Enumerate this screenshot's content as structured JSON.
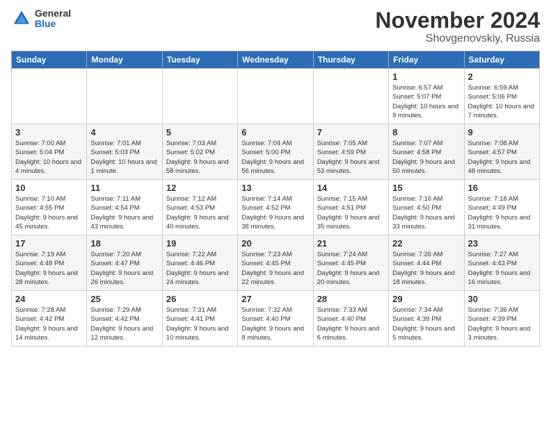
{
  "logo": {
    "general": "General",
    "blue": "Blue"
  },
  "title": "November 2024",
  "subtitle": "Shovgenovskiy, Russia",
  "days_of_week": [
    "Sunday",
    "Monday",
    "Tuesday",
    "Wednesday",
    "Thursday",
    "Friday",
    "Saturday"
  ],
  "weeks": [
    [
      {
        "day": "",
        "info": ""
      },
      {
        "day": "",
        "info": ""
      },
      {
        "day": "",
        "info": ""
      },
      {
        "day": "",
        "info": ""
      },
      {
        "day": "",
        "info": ""
      },
      {
        "day": "1",
        "info": "Sunrise: 6:57 AM\nSunset: 5:07 PM\nDaylight: 10 hours and 9 minutes."
      },
      {
        "day": "2",
        "info": "Sunrise: 6:59 AM\nSunset: 5:06 PM\nDaylight: 10 hours and 7 minutes."
      }
    ],
    [
      {
        "day": "3",
        "info": "Sunrise: 7:00 AM\nSunset: 5:04 PM\nDaylight: 10 hours and 4 minutes."
      },
      {
        "day": "4",
        "info": "Sunrise: 7:01 AM\nSunset: 5:03 PM\nDaylight: 10 hours and 1 minute."
      },
      {
        "day": "5",
        "info": "Sunrise: 7:03 AM\nSunset: 5:02 PM\nDaylight: 9 hours and 58 minutes."
      },
      {
        "day": "6",
        "info": "Sunrise: 7:04 AM\nSunset: 5:00 PM\nDaylight: 9 hours and 56 minutes."
      },
      {
        "day": "7",
        "info": "Sunrise: 7:05 AM\nSunset: 4:59 PM\nDaylight: 9 hours and 53 minutes."
      },
      {
        "day": "8",
        "info": "Sunrise: 7:07 AM\nSunset: 4:58 PM\nDaylight: 9 hours and 50 minutes."
      },
      {
        "day": "9",
        "info": "Sunrise: 7:08 AM\nSunset: 4:57 PM\nDaylight: 9 hours and 48 minutes."
      }
    ],
    [
      {
        "day": "10",
        "info": "Sunrise: 7:10 AM\nSunset: 4:55 PM\nDaylight: 9 hours and 45 minutes."
      },
      {
        "day": "11",
        "info": "Sunrise: 7:11 AM\nSunset: 4:54 PM\nDaylight: 9 hours and 43 minutes."
      },
      {
        "day": "12",
        "info": "Sunrise: 7:12 AM\nSunset: 4:53 PM\nDaylight: 9 hours and 40 minutes."
      },
      {
        "day": "13",
        "info": "Sunrise: 7:14 AM\nSunset: 4:52 PM\nDaylight: 9 hours and 38 minutes."
      },
      {
        "day": "14",
        "info": "Sunrise: 7:15 AM\nSunset: 4:51 PM\nDaylight: 9 hours and 35 minutes."
      },
      {
        "day": "15",
        "info": "Sunrise: 7:16 AM\nSunset: 4:50 PM\nDaylight: 9 hours and 33 minutes."
      },
      {
        "day": "16",
        "info": "Sunrise: 7:18 AM\nSunset: 4:49 PM\nDaylight: 9 hours and 31 minutes."
      }
    ],
    [
      {
        "day": "17",
        "info": "Sunrise: 7:19 AM\nSunset: 4:48 PM\nDaylight: 9 hours and 28 minutes."
      },
      {
        "day": "18",
        "info": "Sunrise: 7:20 AM\nSunset: 4:47 PM\nDaylight: 9 hours and 26 minutes."
      },
      {
        "day": "19",
        "info": "Sunrise: 7:22 AM\nSunset: 4:46 PM\nDaylight: 9 hours and 24 minutes."
      },
      {
        "day": "20",
        "info": "Sunrise: 7:23 AM\nSunset: 4:45 PM\nDaylight: 9 hours and 22 minutes."
      },
      {
        "day": "21",
        "info": "Sunrise: 7:24 AM\nSunset: 4:45 PM\nDaylight: 9 hours and 20 minutes."
      },
      {
        "day": "22",
        "info": "Sunrise: 7:26 AM\nSunset: 4:44 PM\nDaylight: 9 hours and 18 minutes."
      },
      {
        "day": "23",
        "info": "Sunrise: 7:27 AM\nSunset: 4:43 PM\nDaylight: 9 hours and 16 minutes."
      }
    ],
    [
      {
        "day": "24",
        "info": "Sunrise: 7:28 AM\nSunset: 4:42 PM\nDaylight: 9 hours and 14 minutes."
      },
      {
        "day": "25",
        "info": "Sunrise: 7:29 AM\nSunset: 4:42 PM\nDaylight: 9 hours and 12 minutes."
      },
      {
        "day": "26",
        "info": "Sunrise: 7:31 AM\nSunset: 4:41 PM\nDaylight: 9 hours and 10 minutes."
      },
      {
        "day": "27",
        "info": "Sunrise: 7:32 AM\nSunset: 4:40 PM\nDaylight: 9 hours and 8 minutes."
      },
      {
        "day": "28",
        "info": "Sunrise: 7:33 AM\nSunset: 4:40 PM\nDaylight: 9 hours and 6 minutes."
      },
      {
        "day": "29",
        "info": "Sunrise: 7:34 AM\nSunset: 4:39 PM\nDaylight: 9 hours and 5 minutes."
      },
      {
        "day": "30",
        "info": "Sunrise: 7:36 AM\nSunset: 4:39 PM\nDaylight: 9 hours and 3 minutes."
      }
    ]
  ]
}
